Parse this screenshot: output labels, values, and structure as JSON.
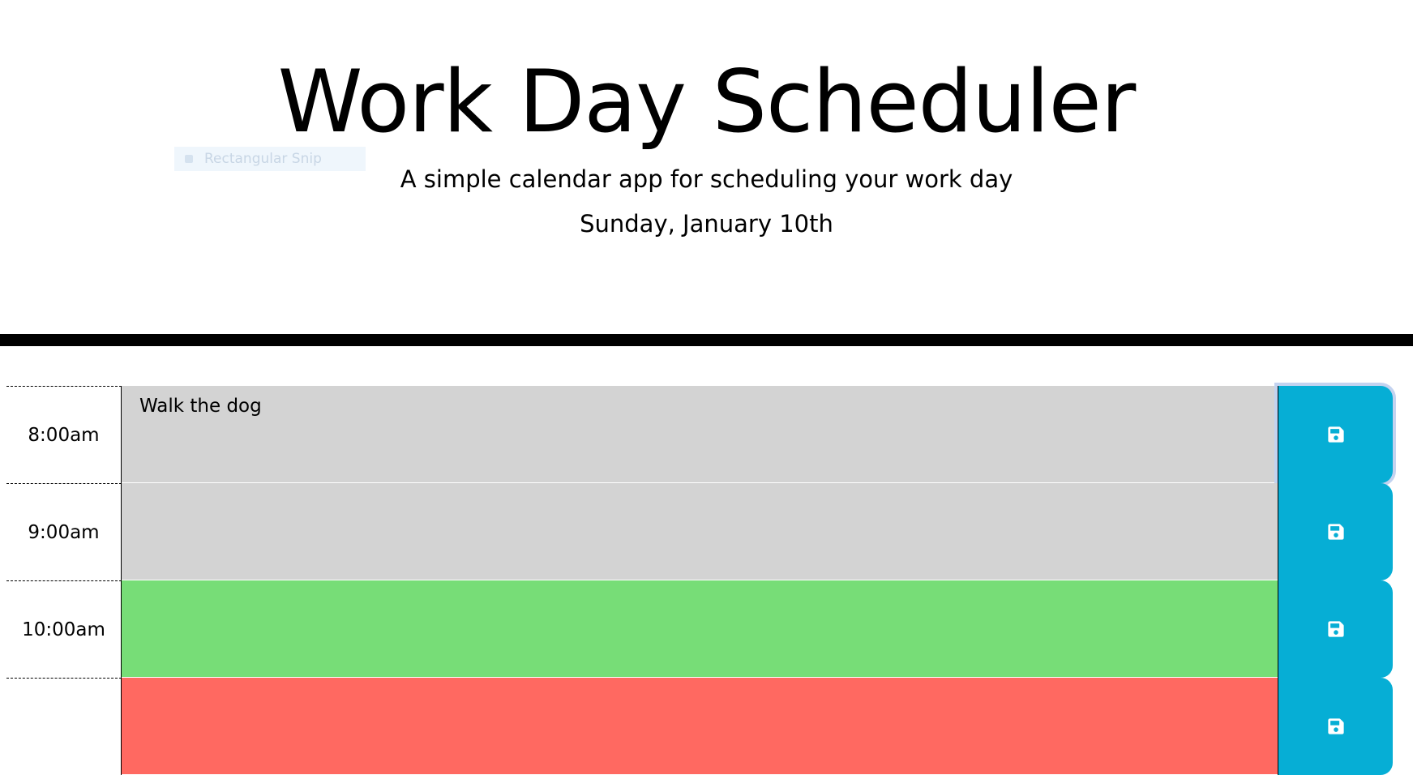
{
  "header": {
    "title": "Work Day Scheduler",
    "subtitle": "A simple calendar app for scheduling your work day",
    "current_day": "Sunday, January 10th"
  },
  "overlay": {
    "snip_label": "Rectangular Snip"
  },
  "colors": {
    "past": "#d3d3d3",
    "present": "#77dd77",
    "future": "#ff6961",
    "save_button": "#06aed5"
  },
  "time_blocks": [
    {
      "hour": "8:00am",
      "text": "Walk the dog",
      "status": "past",
      "save_icon": "save-icon"
    },
    {
      "hour": "9:00am",
      "text": "",
      "status": "past",
      "save_icon": "save-icon"
    },
    {
      "hour": "10:00am",
      "text": "",
      "status": "present",
      "save_icon": "save-icon"
    },
    {
      "hour": "",
      "text": "",
      "status": "future",
      "save_icon": "save-icon"
    }
  ]
}
